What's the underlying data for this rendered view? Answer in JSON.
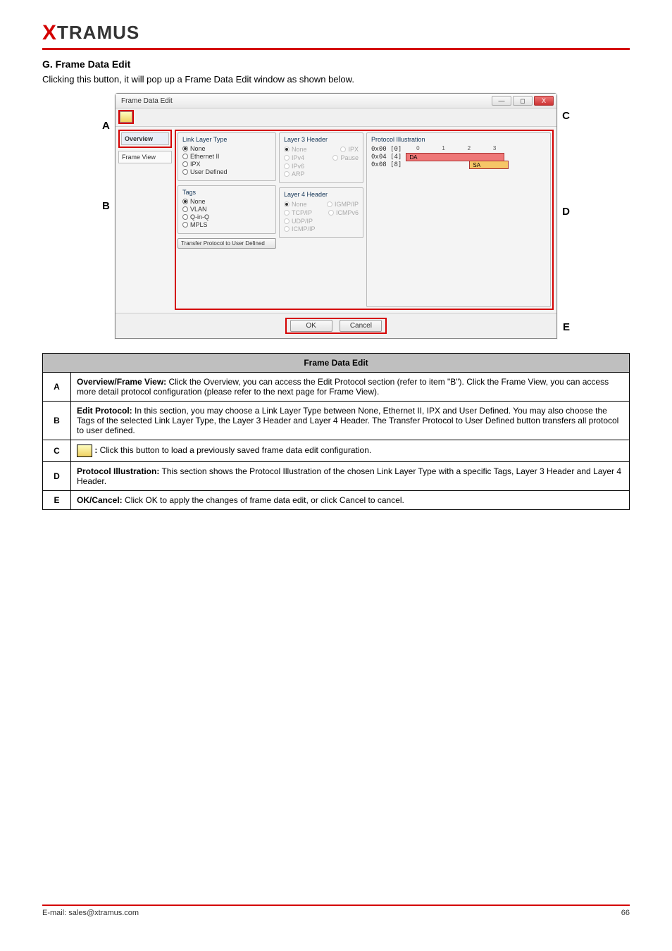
{
  "logo_text_prefix": "X",
  "logo_text_rest": "TRAMUS",
  "section_title": "G. Frame Data Edit",
  "intro": "Clicking this button, it will pop up a Frame Data Edit window as shown below.",
  "callouts": {
    "A": "A",
    "B": "B",
    "C": "C",
    "D": "D",
    "E": "E"
  },
  "dialog": {
    "title": "Frame Data Edit",
    "win_min": "—",
    "win_max": "◻",
    "win_close": "X",
    "sidebar": {
      "overview": "Overview",
      "frameview": "Frame View"
    },
    "linklayer": {
      "title": "Link Layer Type",
      "none": "None",
      "eth2": "Ethernet II",
      "ipx": "IPX",
      "userdef": "User Defined"
    },
    "tags": {
      "title": "Tags",
      "none": "None",
      "vlan": "VLAN",
      "qinq": "Q-in-Q",
      "mpls": "MPLS"
    },
    "transfer_btn": "Transfer Protocol to User Defined",
    "l3": {
      "title": "Layer 3 Header",
      "none": "None",
      "ipx": "IPX",
      "ipv4": "IPv4",
      "pause": "Pause",
      "ipv6": "IPv6",
      "arp": "ARP"
    },
    "l4": {
      "title": "Layer 4 Header",
      "none": "None",
      "igmp": "IGMP/IP",
      "tcp": "TCP/IP",
      "icmpv6": "ICMPv6",
      "udp": "UDP/IP",
      "icmp": "ICMP/IP"
    },
    "illu": {
      "title": "Protocol Illustration",
      "r0": "0x00 [0]",
      "r1": "0x04 [4]",
      "r2": "0x08 [8]",
      "s0": "0",
      "s1": "1",
      "s2": "2",
      "s3": "3",
      "da": "DA",
      "sa": "SA"
    },
    "ok": "OK",
    "cancel": "Cancel"
  },
  "table": {
    "header": "Frame Data Edit",
    "rows": [
      {
        "k": "A",
        "title": "Overview/Frame View:",
        "body": " Click the Overview, you can access the Edit Protocol section (refer to item \"B\"). Click the Frame View, you can access more detail protocol configuration (please refer to the next page for Frame View)."
      },
      {
        "k": "B",
        "title": "Edit Protocol:",
        "body": " In this section, you may choose a Link Layer Type between None, Ethernet II, IPX and User Defined. You may also choose the Tags of the selected Link Layer Type, the Layer 3 Header and Layer 4 Header. The Transfer Protocol to User Defined button transfers all protocol to user defined."
      },
      {
        "k": "C",
        "title": "",
        "body": " Click this button to load a previously saved frame data edit configuration."
      },
      {
        "k": "D",
        "title": "Protocol Illustration:",
        "body": " This section shows the Protocol Illustration of the chosen Link Layer Type with a specific Tags, Layer 3 Header and Layer 4 Header."
      },
      {
        "k": "E",
        "title": "OK/Cancel:",
        "body": " Click OK to apply the changes of frame data edit, or click Cancel to cancel."
      }
    ]
  },
  "footer_left": "E-mail: sales@xtramus.com",
  "footer_right": "66"
}
